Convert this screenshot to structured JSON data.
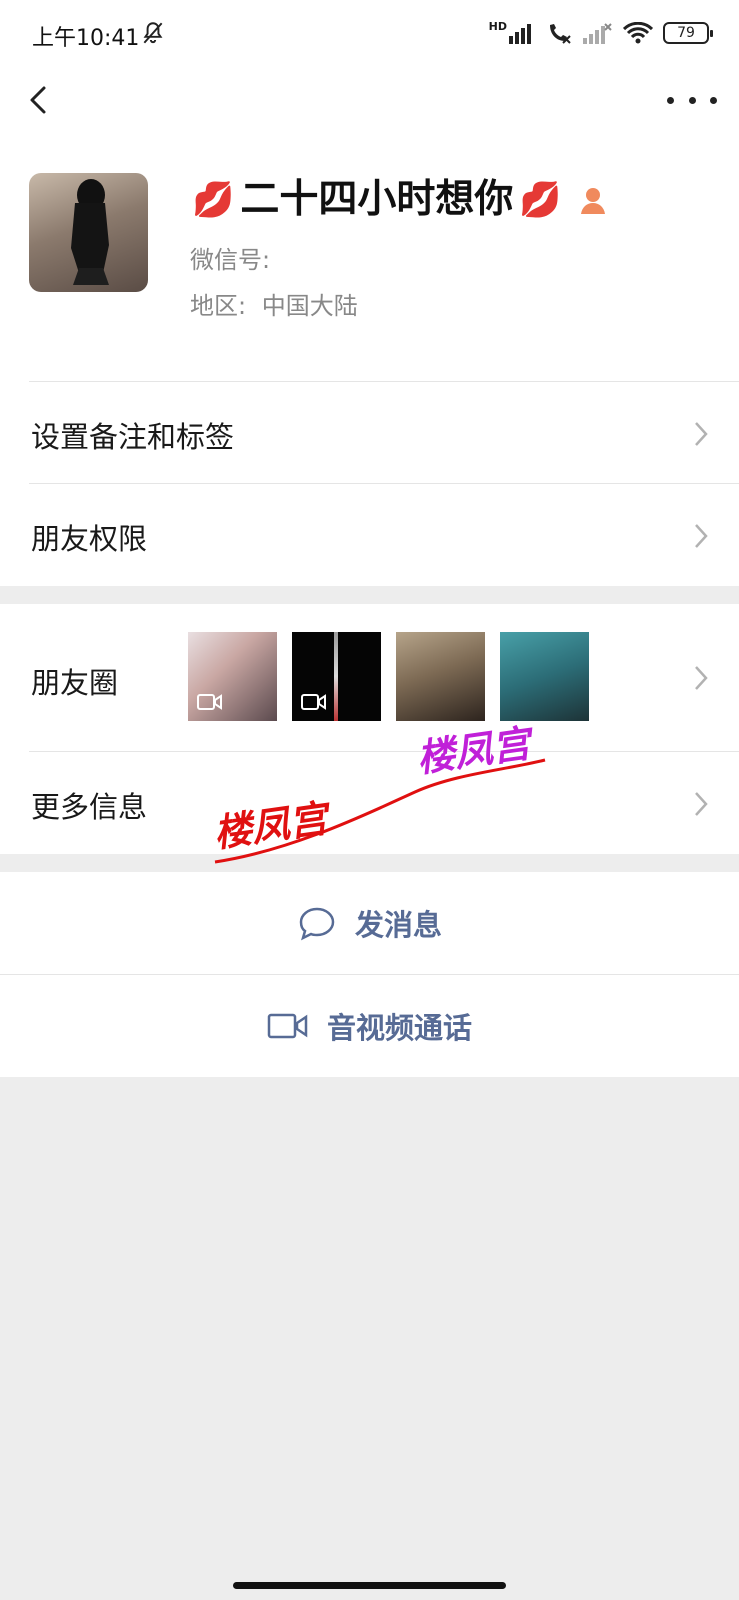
{
  "status_bar": {
    "time": "上午10:41",
    "network_label": "HD",
    "battery": "79"
  },
  "profile": {
    "nickname": "二十四小时想你",
    "decor_emoji_left": "💋",
    "decor_emoji_right": "💋",
    "wechat_id_label": "微信号:",
    "region_label": "地区:",
    "region_value": "中国大陆"
  },
  "rows": {
    "remark_tags": "设置备注和标签",
    "friend_permissions": "朋友权限",
    "moments": "朋友圈",
    "more_info": "更多信息"
  },
  "actions": {
    "send_message": "发消息",
    "video_call": "音视频通话"
  },
  "watermarks": [
    "楼凤宫",
    "楼凤宫"
  ],
  "colors": {
    "link_blue": "#576b95",
    "background_gray": "#ededed",
    "watermark_red": "#e01010",
    "watermark_purple": "#c020d8"
  },
  "icons": [
    "back-arrow-icon",
    "more-dots-icon",
    "chevron-right-icon",
    "chat-bubble-icon",
    "video-camera-icon",
    "person-icon",
    "bell-off-icon",
    "wifi-icon",
    "signal-icon"
  ]
}
